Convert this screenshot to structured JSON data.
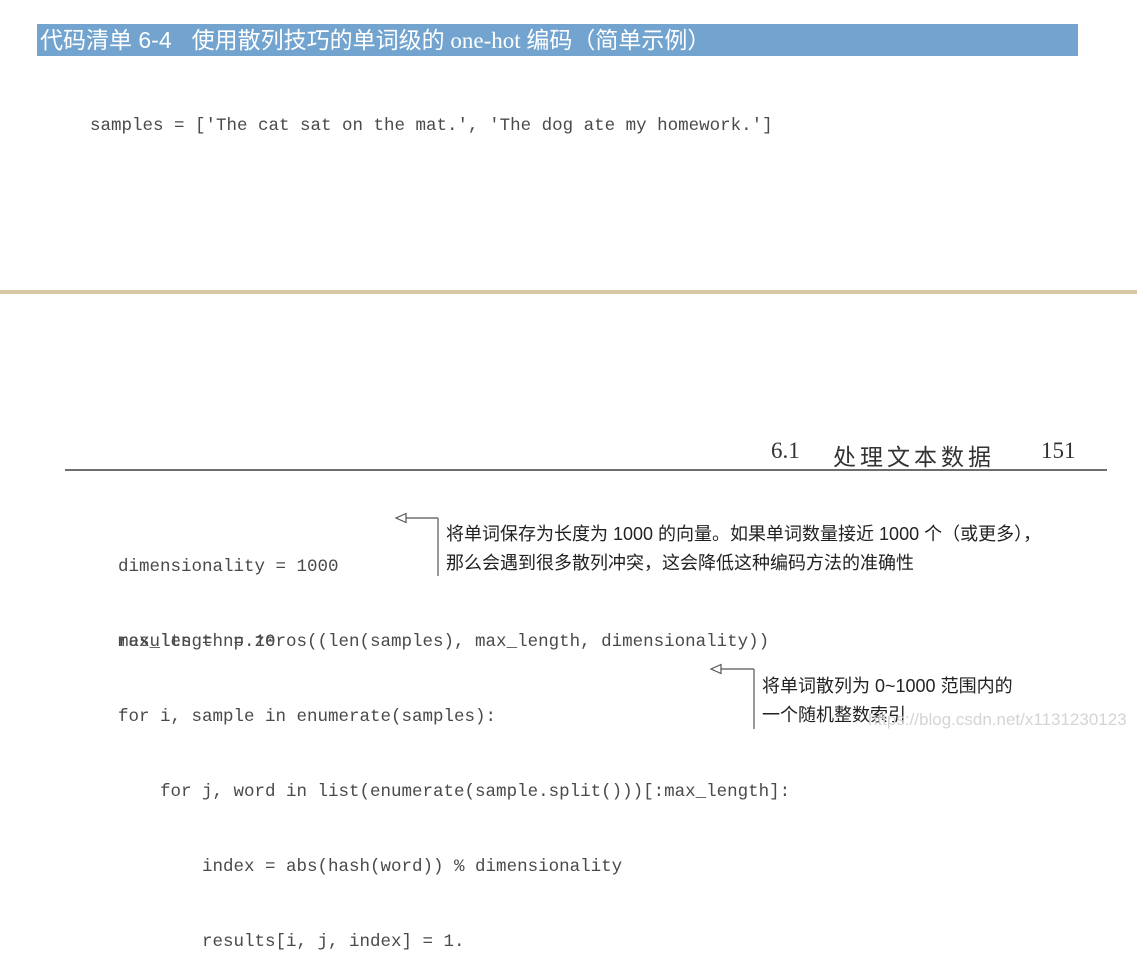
{
  "listing": {
    "label": "代码清单 6-4",
    "title": "使用散列技巧的单词级的 one-hot 编码（简单示例）"
  },
  "code_top": [
    "samples = ['The cat sat on the mat.', 'The dog ate my homework.']"
  ],
  "running_header": {
    "section_number": "6.1",
    "section_title": "处理文本数据",
    "page_number": "151"
  },
  "code_bottom": {
    "block1": [
      "dimensionality = 1000",
      "max_length = 10"
    ],
    "block2": [
      "results = np.zeros((len(samples), max_length, dimensionality))",
      "for i, sample in enumerate(samples):",
      "    for j, word in list(enumerate(sample.split()))[:max_length]:",
      "        index = abs(hash(word)) % dimensionality",
      "        results[i, j, index] = 1."
    ]
  },
  "annotations": [
    {
      "lines": [
        "将单词保存为长度为 1000 的向量。如果单词数量接近 1000 个（或更多），",
        "那么会遇到很多散列冲突，这会降低这种编码方法的准确性"
      ]
    },
    {
      "lines": [
        "将单词散列为 0~1000 范围内的",
        "一个随机整数索引"
      ]
    }
  ],
  "watermark": "https://blog.csdn.net/x1131230123",
  "colors": {
    "title_bar": "#72a4cf",
    "divider": "#d8c7a4"
  }
}
